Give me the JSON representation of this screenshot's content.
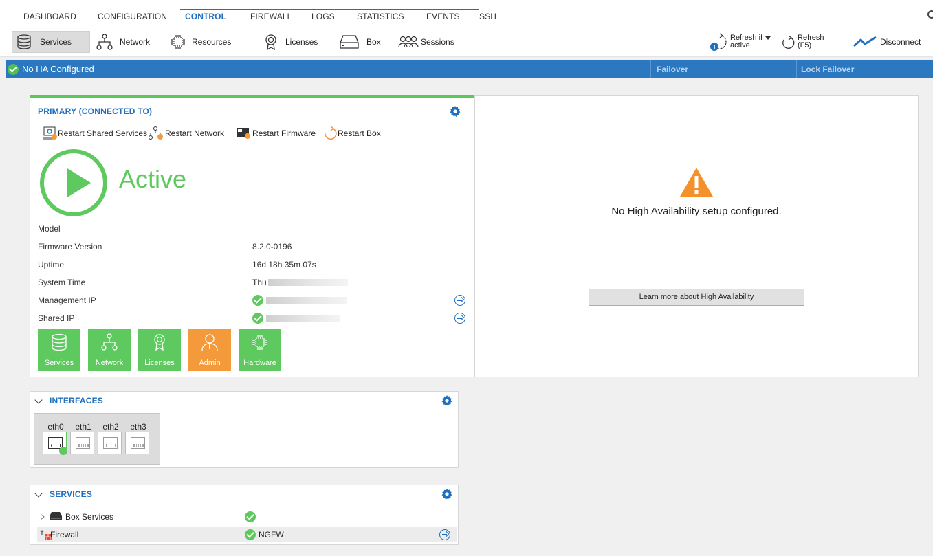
{
  "topnav": {
    "tabs": [
      "DASHBOARD",
      "CONFIGURATION",
      "CONTROL",
      "FIREWALL",
      "LOGS",
      "STATISTICS",
      "EVENTS",
      "SSH"
    ],
    "active_tab": "CONTROL"
  },
  "toolbar": {
    "services": "Services",
    "network": "Network",
    "resources": "Resources",
    "licenses": "Licenses",
    "box": "Box",
    "sessions": "Sessions",
    "refresh_if_line1": "Refresh if",
    "refresh_if_line2": "active",
    "refresh_line1": "Refresh",
    "refresh_line2": "(F5)",
    "disconnect": "Disconnect"
  },
  "statusbar": {
    "message": "No HA Configured",
    "failover": "Failover",
    "lock_failover": "Lock Failover"
  },
  "primary": {
    "title": "PRIMARY (CONNECTED TO)",
    "restart_shared_services": "Restart Shared Services",
    "restart_network": "Restart Network",
    "restart_firmware": "Restart Firmware",
    "restart_box": "Restart Box",
    "state": "Active",
    "labels": {
      "model": "Model",
      "firmware": "Firmware Version",
      "uptime": "Uptime",
      "system_time": "System Time",
      "mgmt_ip": "Management IP",
      "shared_ip": "Shared IP"
    },
    "values": {
      "firmware": "8.2.0-0196",
      "uptime": "16d 18h 35m 07s",
      "system_time": "Thu"
    },
    "tiles": [
      "Services",
      "Network",
      "Licenses",
      "Admin",
      "Hardware"
    ]
  },
  "ha": {
    "message": "No High Availability setup configured.",
    "button": "Learn more about High Availability"
  },
  "interfaces": {
    "title": "INTERFACES",
    "ports": [
      "eth0",
      "eth1",
      "eth2",
      "eth3"
    ]
  },
  "services": {
    "title": "SERVICES",
    "rows": [
      {
        "name": "Box Services",
        "value": ""
      },
      {
        "name": "Firewall",
        "value": "NGFW"
      }
    ]
  },
  "colors": {
    "accent": "#1f6fbf",
    "status_bar": "#2c78c0",
    "ok_green": "#5ec95e",
    "admin_orange": "#f59a3b"
  }
}
